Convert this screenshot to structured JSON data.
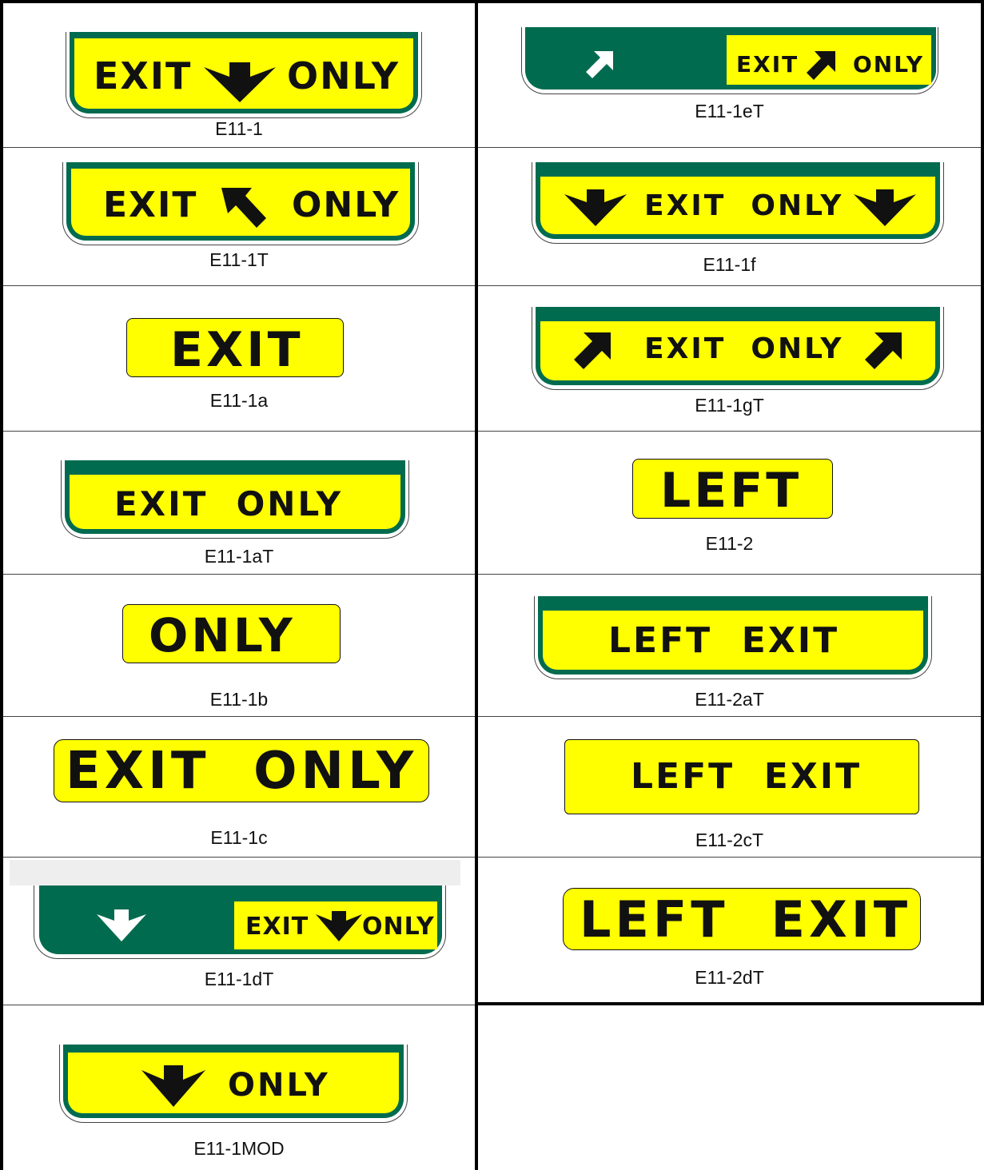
{
  "colors": {
    "sign_yellow": "#ffff00",
    "sign_green": "#006b4f",
    "legend_black": "#111111"
  },
  "left_column": [
    {
      "code": "E11-1",
      "legend": [
        "EXIT",
        "ONLY"
      ],
      "arrow": "down-arrow-icon"
    },
    {
      "code": "E11-1T",
      "legend": [
        "EXIT",
        "ONLY"
      ],
      "arrow": "up-left-arrow-icon"
    },
    {
      "code": "E11-1a",
      "legend": [
        "EXIT"
      ]
    },
    {
      "code": "E11-1aT",
      "legend": [
        "EXIT  ONLY"
      ]
    },
    {
      "code": "E11-1b",
      "legend": [
        "ONLY"
      ]
    },
    {
      "code": "E11-1c",
      "legend": [
        "EXIT  ONLY"
      ]
    },
    {
      "code": "E11-1dT",
      "legend": [
        "EXIT",
        "ONLY"
      ],
      "arrow": "down-arrow-icon"
    },
    {
      "code": "E11-1MOD",
      "legend": [
        "ONLY"
      ],
      "arrow": "down-arrow-icon"
    }
  ],
  "right_column": [
    {
      "code": "E11-1eT",
      "legend": [
        "EXIT",
        "ONLY"
      ],
      "arrow": "up-right-arrow-icon"
    },
    {
      "code": "E11-1f",
      "legend": [
        "EXIT  ONLY"
      ],
      "arrow": "down-arrow-icon"
    },
    {
      "code": "E11-1gT",
      "legend": [
        "EXIT  ONLY"
      ],
      "arrow": "up-right-arrow-icon"
    },
    {
      "code": "E11-2",
      "legend": [
        "LEFT"
      ]
    },
    {
      "code": "E11-2aT",
      "legend": [
        "LEFT  EXIT"
      ]
    },
    {
      "code": "E11-2cT",
      "legend": [
        "LEFT  EXIT"
      ]
    },
    {
      "code": "E11-2dT",
      "legend": [
        "LEFT  EXIT"
      ]
    }
  ]
}
